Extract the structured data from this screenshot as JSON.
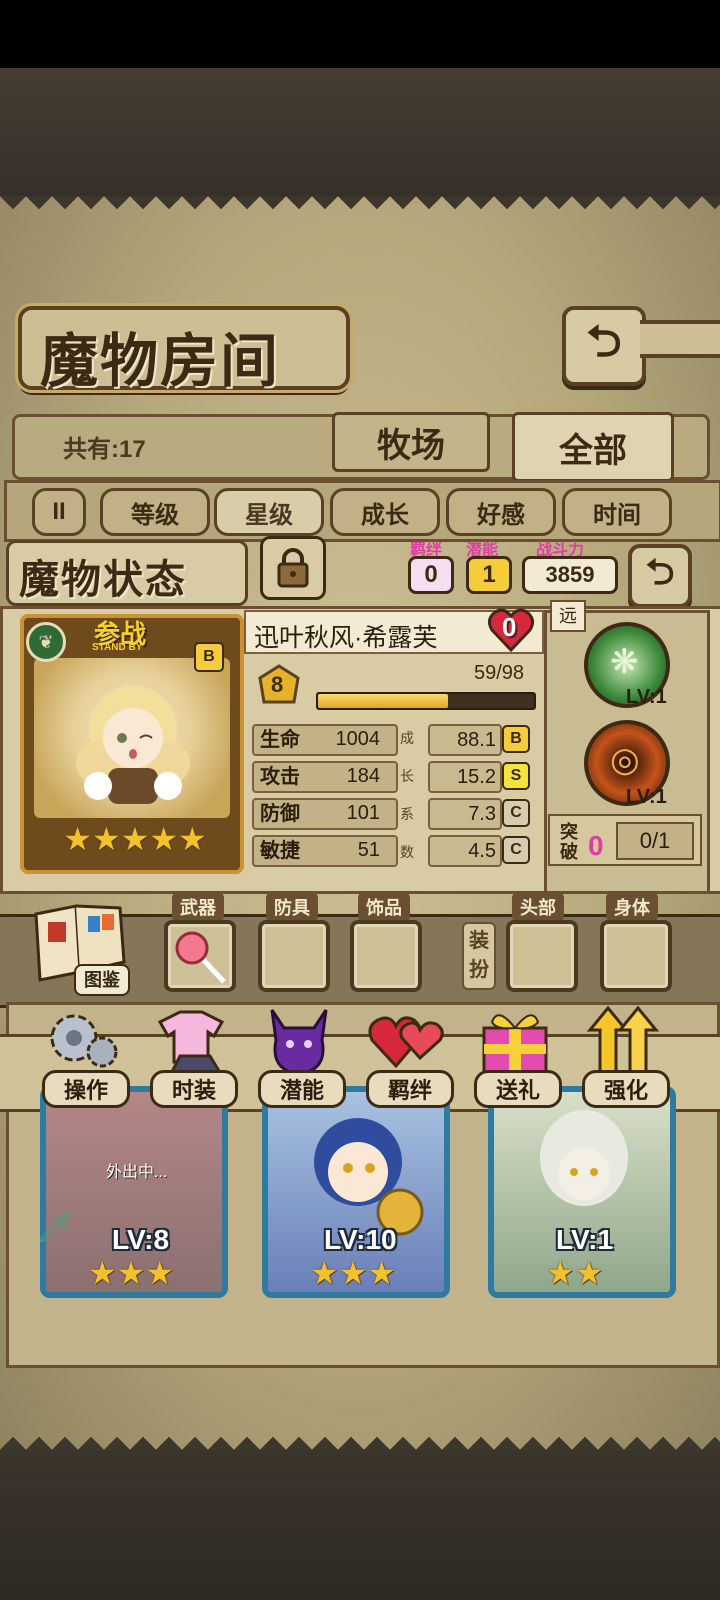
{
  "header": {
    "title": "魔物房间",
    "back_icon": "back-arrow-icon"
  },
  "summary": {
    "count_text": "共有:17"
  },
  "tabs": [
    {
      "label": "牧场"
    },
    {
      "label": "全部"
    }
  ],
  "sort": {
    "pause_glyph": "II",
    "buttons": [
      {
        "label": "等级"
      },
      {
        "label": "星级"
      },
      {
        "label": "成长"
      },
      {
        "label": "好感"
      },
      {
        "label": "时间"
      }
    ]
  },
  "status": {
    "title": "魔物状态",
    "bond_label": "羁绊",
    "bond_value": "0",
    "potential_label": "潜能",
    "potential_value": "1",
    "power_label": "战斗力",
    "power_value": "3859",
    "card_badge": "参战",
    "card_badge_sub": "STAND BY",
    "rarity": "B",
    "stars": 5,
    "name": "迅叶秋风·希露芙",
    "heart_value": "0",
    "level": "8",
    "exp_text": "59/98",
    "exp_fraction": 0.6,
    "stats": [
      {
        "label": "生命",
        "value": "1004",
        "growth": "88.1",
        "grade": "B"
      },
      {
        "label": "攻击",
        "value": "184",
        "growth": "15.2",
        "grade": "S"
      },
      {
        "label": "防御",
        "value": "101",
        "growth": "7.3",
        "grade": "C"
      },
      {
        "label": "敏捷",
        "value": "51",
        "growth": "4.5",
        "grade": "C"
      }
    ],
    "growth_chars": [
      "成",
      "长",
      "系",
      "数"
    ],
    "range_label": "远",
    "skills": [
      {
        "lv": "LV:1"
      },
      {
        "lv": "LV:1"
      }
    ],
    "breakthrough_label_1": "突",
    "breakthrough_label_2": "破",
    "breakthrough_value": "0",
    "breakthrough_progress": "0/1"
  },
  "equipment": {
    "book_label": "图鉴",
    "weapon_label": "武器",
    "armor_label": "防具",
    "accessory_label": "饰品",
    "dress_label_1": "装",
    "dress_label_2": "扮",
    "head_label": "头部",
    "body_label": "身体"
  },
  "actions": [
    {
      "label": "操作"
    },
    {
      "label": "时装"
    },
    {
      "label": "潜能"
    },
    {
      "label": "羁绊"
    },
    {
      "label": "送礼"
    },
    {
      "label": "强化"
    }
  ],
  "cards": [
    {
      "lv": "LV:8",
      "stars": 3,
      "status": "外出中..."
    },
    {
      "lv": "LV:10",
      "stars": 3
    },
    {
      "lv": "LV:1",
      "stars": 2
    }
  ],
  "colors": {
    "accent_gold": "#e6b22a",
    "panel": "#d9cca4",
    "card_border": "#2e7aa0",
    "heart": "#d6283a",
    "pink": "#e23ba6"
  }
}
